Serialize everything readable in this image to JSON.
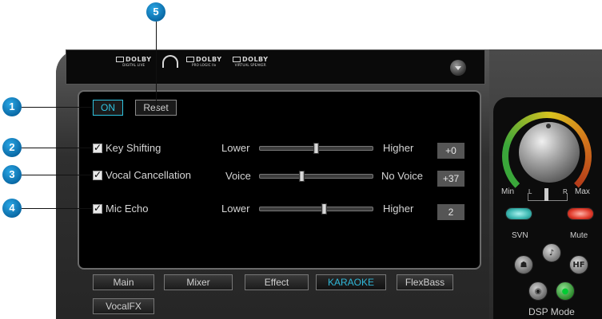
{
  "top_logos": [
    {
      "label": "DOLBY",
      "sub": "DIGITAL LIVE"
    },
    {
      "label": "DOLBY",
      "sub": "PRO LOGIC IIx"
    },
    {
      "label": "DOLBY",
      "sub": "VIRTUAL SPEAKER"
    }
  ],
  "controls": {
    "on_label": "ON",
    "reset_label": "Reset"
  },
  "rows": [
    {
      "name": "Key Shifting",
      "checked": true,
      "left": "Lower",
      "right": "Higher",
      "value": "+0",
      "level": 0.5
    },
    {
      "name": "Vocal Cancellation",
      "checked": true,
      "left": "Voice",
      "right": "No Voice",
      "value": "+37",
      "level": 0.37
    },
    {
      "name": "Mic Echo",
      "checked": true,
      "left": "Lower",
      "right": "Higher",
      "value": "2",
      "level": 0.57
    }
  ],
  "tabs": [
    {
      "label": "Main",
      "active": false
    },
    {
      "label": "Mixer",
      "active": false
    },
    {
      "label": "Effect",
      "active": false
    },
    {
      "label": "KARAOKE",
      "active": true
    },
    {
      "label": "FlexBass",
      "active": false
    },
    {
      "label": "VocalFX",
      "active": false
    }
  ],
  "right_panel": {
    "min_label": "Min",
    "max_label": "Max",
    "l_label": "L",
    "r_label": "R",
    "svn_label": "SVN",
    "mute_label": "Mute",
    "dsp_label": "DSP Mode",
    "hf_label": "HF"
  },
  "callouts": [
    "1",
    "2",
    "3",
    "4",
    "5"
  ],
  "colors": {
    "accent": "#2fb7d8",
    "callout": "#1a8ccc",
    "svn": "#3ab6b0",
    "mute": "#e03a2a"
  }
}
